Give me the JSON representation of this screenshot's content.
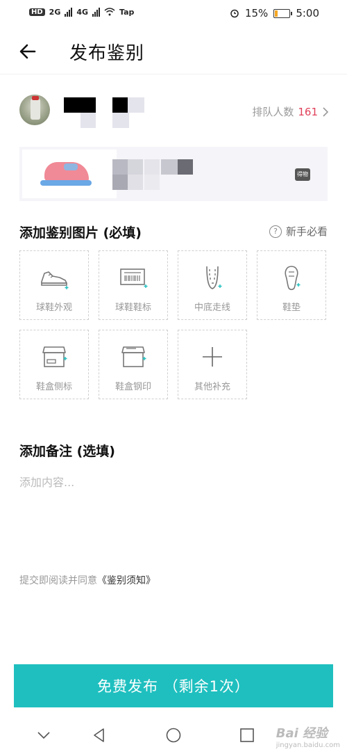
{
  "status_bar": {
    "hd": "HD",
    "net1": "2G",
    "net2": "4G",
    "tap": "Tap",
    "battery": "15%",
    "time": "5:00"
  },
  "header": {
    "title": "发布鉴别"
  },
  "user": {
    "queue_label": "排队人数",
    "queue_count": "161"
  },
  "product": {
    "badge": "得物"
  },
  "upload": {
    "title": "添加鉴别图片 (必填)",
    "help": "新手必看",
    "slots": [
      {
        "label": "球鞋外观",
        "icon": "sneaker-icon"
      },
      {
        "label": "球鞋鞋标",
        "icon": "barcode-icon"
      },
      {
        "label": "中底走线",
        "icon": "stitching-icon"
      },
      {
        "label": "鞋垫",
        "icon": "insole-icon"
      },
      {
        "label": "鞋盒侧标",
        "icon": "box-side-icon"
      },
      {
        "label": "鞋盒钢印",
        "icon": "box-stamp-icon"
      },
      {
        "label": "其他补充",
        "icon": "plus-icon"
      }
    ]
  },
  "note": {
    "title": "添加备注 (选填)",
    "placeholder": "添加内容..."
  },
  "agreement": {
    "prefix": "提交即阅读并同意",
    "link": "《鉴别须知》"
  },
  "submit": {
    "label": "免费发布 （剩余1次）"
  },
  "watermark": {
    "text": "Bai 经验",
    "sub": "jingyan.baidu.com"
  },
  "colors": {
    "accent": "#1fbfbf",
    "count": "#e0405a"
  }
}
